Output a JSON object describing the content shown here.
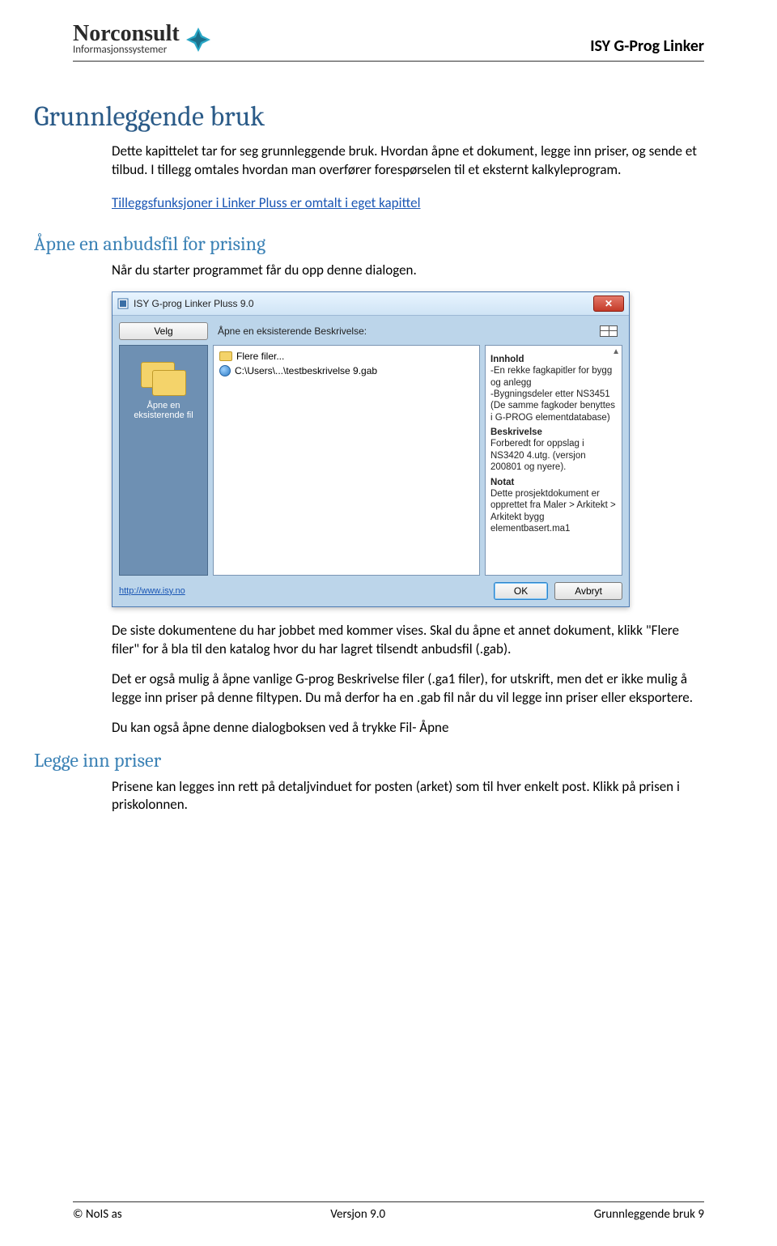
{
  "header": {
    "logo_main": "Norconsult",
    "logo_sub": "Informasjonssystemer",
    "product": "ISY G-Prog Linker"
  },
  "h1": "Grunnleggende bruk",
  "p1": "Dette kapittelet tar for seg grunnleggende bruk. Hvordan åpne et dokument, legge inn priser, og sende et tilbud. I tillegg omtales hvordan man overfører forespørselen til et eksternt kalkyleprogram.",
  "link_text": "Tilleggsfunksjoner i Linker Pluss er omtalt i eget kapittel",
  "h2_a": "Åpne en anbudsfil for prising",
  "p2": "Når du starter programmet får du opp denne dialogen.",
  "dialog": {
    "title": "ISY G-prog Linker Pluss 9.0",
    "velg_label": "Velg",
    "subtitle": "Åpne en eksisterende Beskrivelse:",
    "left_label": "Åpne en eksisterende fil",
    "list": {
      "item1": "Flere filer...",
      "item2": "C:\\Users\\...\\testbeskrivelse 9.gab"
    },
    "right": {
      "h1": "Innhold",
      "t1": "-En rekke fagkapitler for bygg og anlegg\n-Bygningsdeler etter NS3451\n(De samme fagkoder benyttes i G-PROG elementdatabase)",
      "h2": "Beskrivelse",
      "t2": "Forberedt for oppslag i NS3420  4.utg. (versjon 200801 og nyere).",
      "h3": "Notat",
      "t3": "Dette prosjektdokument er opprettet fra Maler > Arkitekt > Arkitekt bygg elementbasert.ma1"
    },
    "bottom_link": "http://www.isy.no",
    "ok": "OK",
    "cancel": "Avbryt"
  },
  "p3": "De siste dokumentene du har jobbet med kommer vises. Skal du åpne et annet dokument, klikk \"Flere filer\" for å bla til den katalog hvor du har lagret tilsendt anbudsfil (.gab).",
  "p4": "Det er også mulig å åpne vanlige G-prog Beskrivelse filer (.ga1 filer), for utskrift, men det er ikke mulig å legge inn priser på denne filtypen. Du må derfor ha en .gab fil når du vil legge inn priser eller eksportere.",
  "p5": "Du kan også åpne denne dialogboksen ved å trykke Fil- Åpne",
  "h2_b": "Legge inn priser",
  "p6": "Prisene kan legges inn rett på detaljvinduet for posten (arket) som til hver enkelt post. Klikk på prisen i priskolonnen.",
  "footer": {
    "left": "© NoIS as",
    "center": "Versjon 9.0",
    "right": "Grunnleggende bruk 9"
  }
}
